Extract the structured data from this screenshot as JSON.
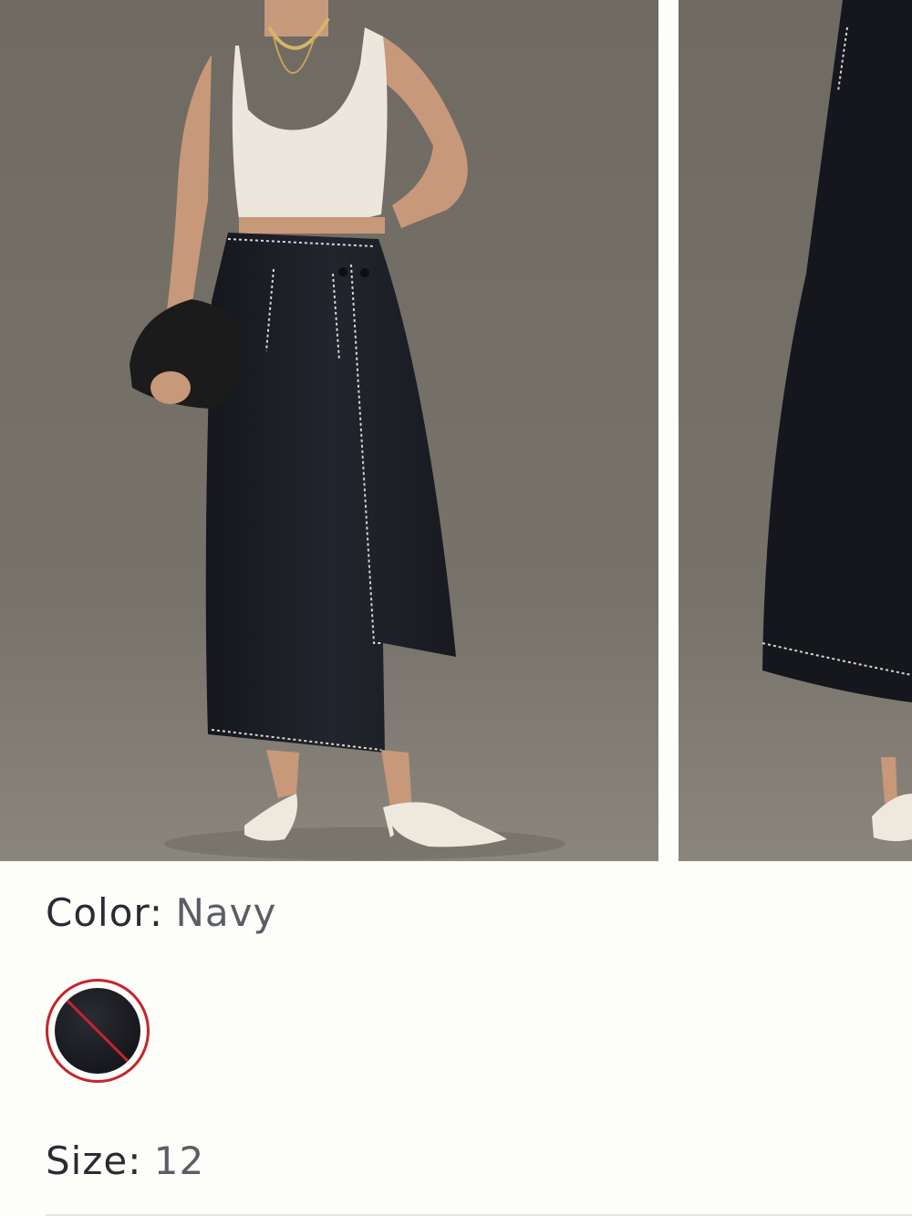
{
  "color": {
    "label": "Color:",
    "value": "Navy"
  },
  "swatches": [
    {
      "name": "Navy",
      "available": false,
      "hex": "#17181d"
    }
  ],
  "size": {
    "label": "Size:",
    "value": "12"
  },
  "icons": {
    "unavailable": "slash-icon"
  },
  "colors": {
    "accent_unavailable": "#c4252c",
    "text": "#2a2b33",
    "text_muted": "#5b5d66"
  }
}
